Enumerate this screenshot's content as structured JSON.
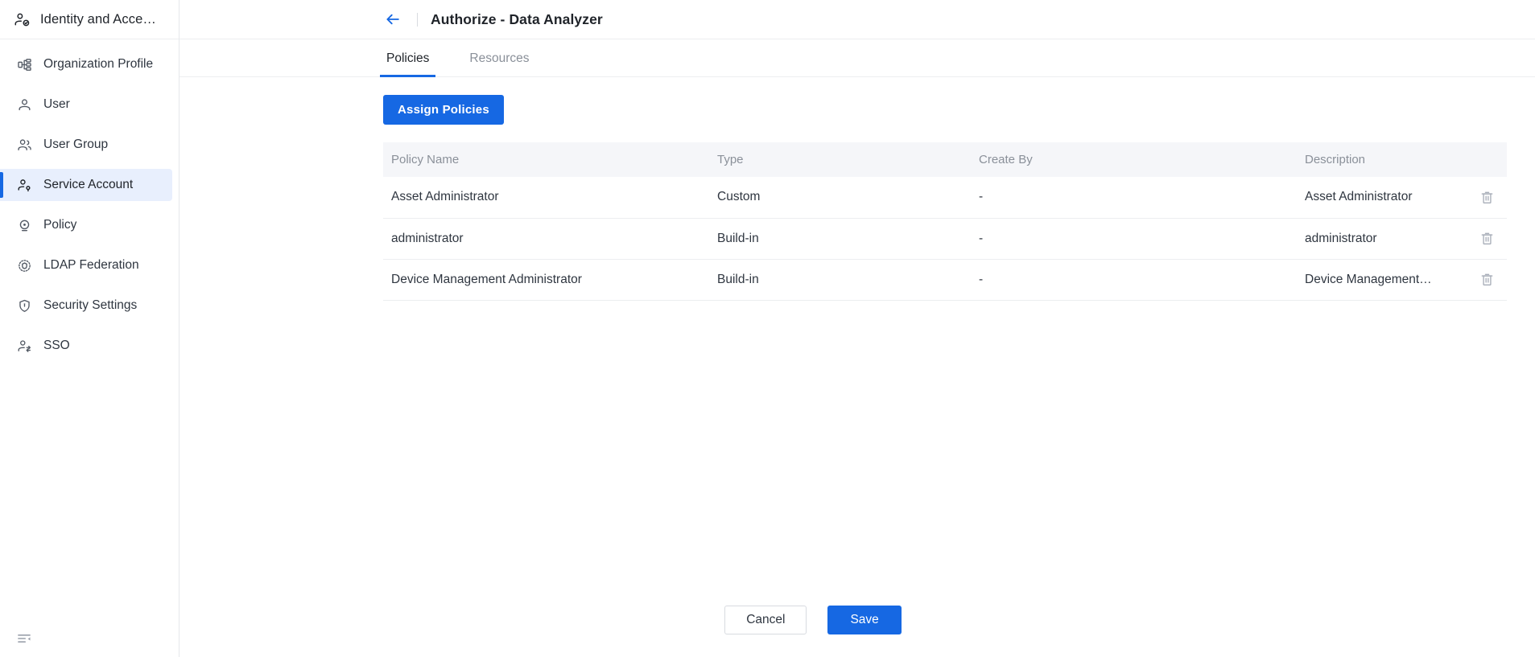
{
  "sidebar": {
    "brand": {
      "title": "Identity and Acce…",
      "icon": "identity-access-icon"
    },
    "items": [
      {
        "label": "Organization Profile",
        "icon": "org-chart-icon",
        "active": false
      },
      {
        "label": "User",
        "icon": "user-icon",
        "active": false
      },
      {
        "label": "User Group",
        "icon": "user-group-icon",
        "active": false
      },
      {
        "label": "Service Account",
        "icon": "service-account-icon",
        "active": true
      },
      {
        "label": "Policy",
        "icon": "policy-target-icon",
        "active": false
      },
      {
        "label": "LDAP Federation",
        "icon": "ldap-federation-icon",
        "active": false
      },
      {
        "label": "Security Settings",
        "icon": "shield-lock-icon",
        "active": false
      },
      {
        "label": "SSO",
        "icon": "sso-user-arrow-icon",
        "active": false
      }
    ],
    "collapse_icon": "collapse-sidebar-icon"
  },
  "header": {
    "back_icon": "back-arrow-icon",
    "title": "Authorize - Data Analyzer"
  },
  "tabs": [
    {
      "label": "Policies",
      "active": true
    },
    {
      "label": "Resources",
      "active": false
    }
  ],
  "toolbar": {
    "assign_policies_label": "Assign Policies"
  },
  "table": {
    "columns": [
      "Policy Name",
      "Type",
      "Create By",
      "Description",
      ""
    ],
    "rows": [
      {
        "policy_name": "Asset Administrator",
        "type": "Custom",
        "create_by": "-",
        "description": "Asset Administrator",
        "delete_icon": "trash-icon"
      },
      {
        "policy_name": "administrator",
        "type": "Build-in",
        "create_by": "-",
        "description": "administrator",
        "delete_icon": "trash-icon"
      },
      {
        "policy_name": "Device Management Administrator",
        "type": "Build-in",
        "create_by": "-",
        "description": "Device Management Administrator",
        "delete_icon": "trash-icon"
      }
    ]
  },
  "footer": {
    "cancel_label": "Cancel",
    "save_label": "Save"
  },
  "colors": {
    "accent": "#1668e3",
    "active_nav_bg": "#e8effd",
    "table_header_bg": "#f5f6f9",
    "border": "#eceef0",
    "text_primary": "#1f2329",
    "text_muted": "#8a9099"
  }
}
